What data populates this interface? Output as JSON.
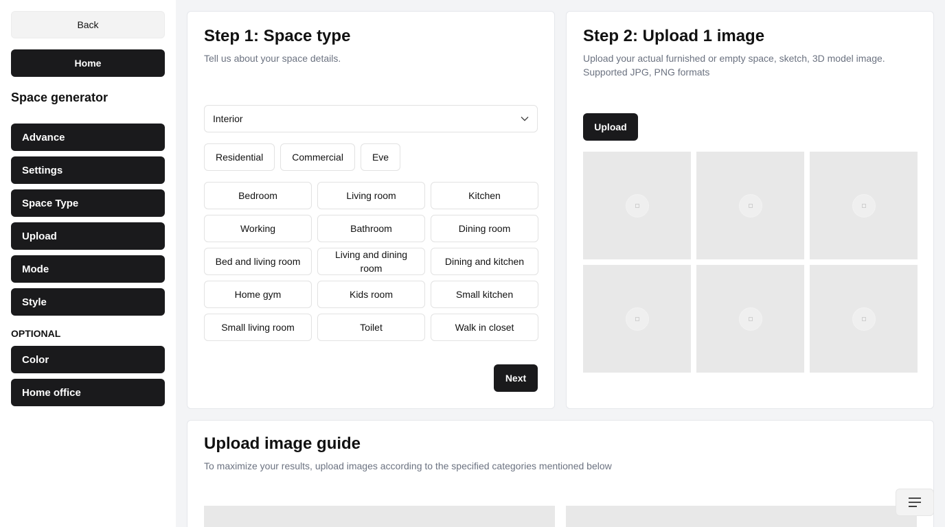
{
  "sidebar": {
    "back_label": "Back",
    "home_label": "Home",
    "title": "Space generator",
    "items": [
      "Advance",
      "Settings",
      "Space Type",
      "Upload",
      "Mode",
      "Style"
    ],
    "optional_heading": "OPTIONAL",
    "optional_items": [
      "Color",
      "Home office"
    ]
  },
  "step1": {
    "title": "Step 1: Space type",
    "subtitle": "Tell us about your space details.",
    "select_value": "Interior",
    "categories": [
      "Residential",
      "Commercial",
      "Eve"
    ],
    "rooms": [
      "Bedroom",
      "Living room",
      "Kitchen",
      "Working",
      "Bathroom",
      "Dining room",
      "Bed and living room",
      "Living and dining room",
      "Dining and kitchen",
      "Home gym",
      "Kids room",
      "Small kitchen",
      "Small living room",
      "Toilet",
      "Walk in closet"
    ],
    "next_label": "Next"
  },
  "step2": {
    "title": "Step 2: Upload 1 image",
    "subtitle": "Upload your actual furnished or empty space, sketch, 3D model image. Supported JPG, PNG formats",
    "upload_label": "Upload"
  },
  "guide": {
    "title": "Upload image guide",
    "subtitle": "To maximize your results, upload images according to the specified categories mentioned below"
  },
  "icons": {
    "select_chevron": "chevron-down-icon",
    "thumb_placeholder": "image-placeholder-icon",
    "menu": "menu-icon"
  },
  "colors": {
    "dark_button": "#1a1a1c",
    "page_bg": "#f3f4f6",
    "placeholder": "#e8e8e8"
  }
}
